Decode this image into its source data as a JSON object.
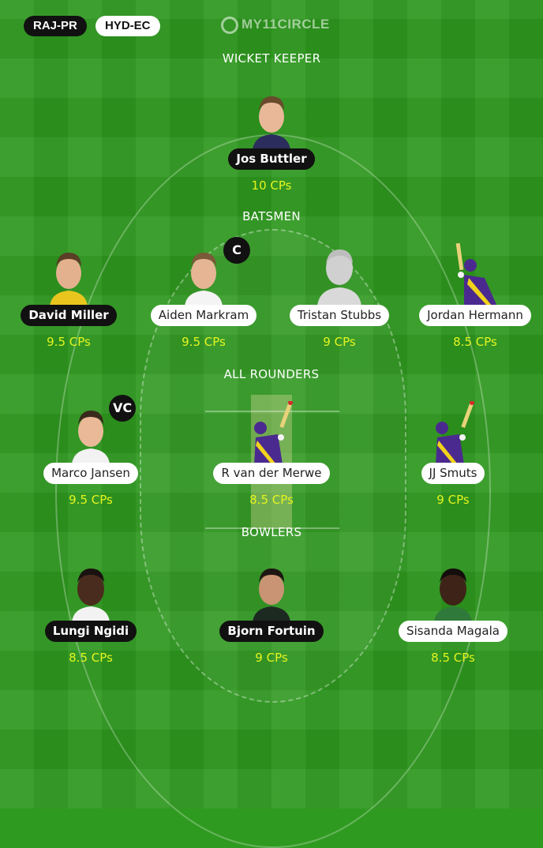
{
  "header": {
    "team1": "RAJ-PR",
    "team2": "HYD-EC",
    "logo_text": "MY11CIRCLE"
  },
  "sections": {
    "wicket_keeper": "WICKET KEEPER",
    "batsmen": "BATSMEN",
    "all_rounders": "ALL ROUNDERS",
    "bowlers": "BOWLERS"
  },
  "players": {
    "wk": [
      {
        "name": "Jos Buttler",
        "cp": "10 CPs",
        "style": "dark"
      }
    ],
    "bat": [
      {
        "name": "David Miller",
        "cp": "9.5 CPs",
        "style": "dark"
      },
      {
        "name": "Aiden Markram",
        "cp": "9.5 CPs",
        "style": "light",
        "badge": "C"
      },
      {
        "name": "Tristan Stubbs",
        "cp": "9 CPs",
        "style": "light"
      },
      {
        "name": "Jordan Hermann",
        "cp": "8.5 CPs",
        "style": "light"
      }
    ],
    "ar": [
      {
        "name": "Marco Jansen",
        "cp": "9.5 CPs",
        "style": "light",
        "badge": "VC"
      },
      {
        "name": "R van der Merwe",
        "cp": "8.5 CPs",
        "style": "light"
      },
      {
        "name": "JJ Smuts",
        "cp": "9 CPs",
        "style": "light"
      }
    ],
    "bowl": [
      {
        "name": "Lungi Ngidi",
        "cp": "8.5 CPs",
        "style": "dark"
      },
      {
        "name": "Bjorn Fortuin",
        "cp": "9 CPs",
        "style": "dark"
      },
      {
        "name": "Sisanda Magala",
        "cp": "8.5 CPs",
        "style": "light"
      }
    ]
  },
  "colors": {
    "field": "#2e981e",
    "credits": "#e4f51f",
    "jersey_purple": "#4b2a8f",
    "jersey_yellow": "#f2d21b"
  }
}
